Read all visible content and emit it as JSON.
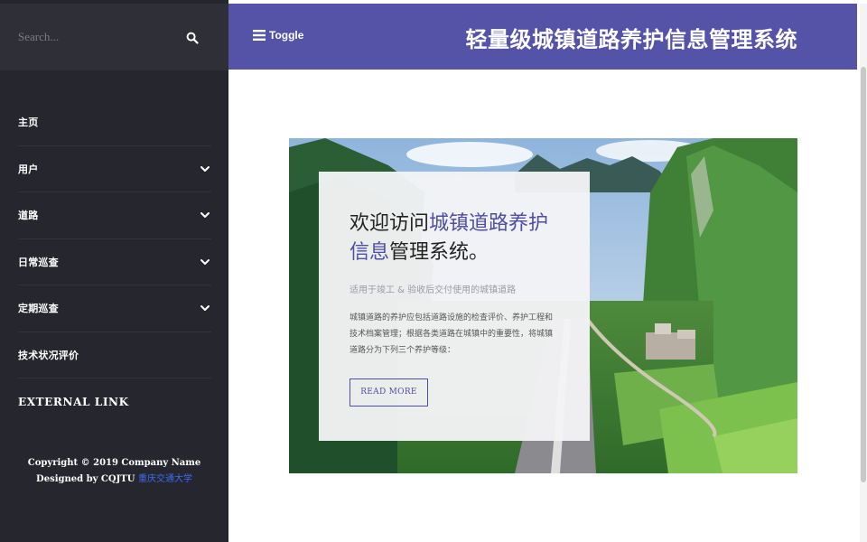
{
  "search": {
    "placeholder": "Search..."
  },
  "sidebar": {
    "items": [
      {
        "label": "主页",
        "has_submenu": false
      },
      {
        "label": "用户",
        "has_submenu": true
      },
      {
        "label": "道路",
        "has_submenu": true
      },
      {
        "label": "日常巡查",
        "has_submenu": true
      },
      {
        "label": "定期巡查",
        "has_submenu": true
      },
      {
        "label": "技术状况评价",
        "has_submenu": false
      },
      {
        "label": "EXTERNAL LINK",
        "has_submenu": false
      }
    ],
    "footer": {
      "copyright": "Copyright © 2019 Company Name",
      "designed_by": "Designed by CQJTU",
      "link_text": "重庆交通大学"
    }
  },
  "header": {
    "toggle_label": "Toggle",
    "title": "轻量级城镇道路养护信息管理系统"
  },
  "hero": {
    "title_prefix": "欢迎访问",
    "title_highlight": "城镇道路养护信息",
    "title_suffix": "管理系统。",
    "subtitle": "适用于竣工 & 验收后交付使用的城镇道路",
    "body": "城镇道路的养护应包括道路设施的检查评价、养护工程和技术档案管理；根据各类道路在城镇中的重要性，将城镇道路分为下列三个养护等级：",
    "button_label": "READ MORE"
  },
  "colors": {
    "sidebar_bg": "#26262e",
    "search_bg": "#2f2f38",
    "header_bg": "#5553a8",
    "accent": "#4f4da6",
    "footer_link": "#3c6cf0"
  },
  "icons": {
    "search": "search-icon",
    "chevron": "chevron-down-icon",
    "toggle": "hamburger-icon"
  }
}
